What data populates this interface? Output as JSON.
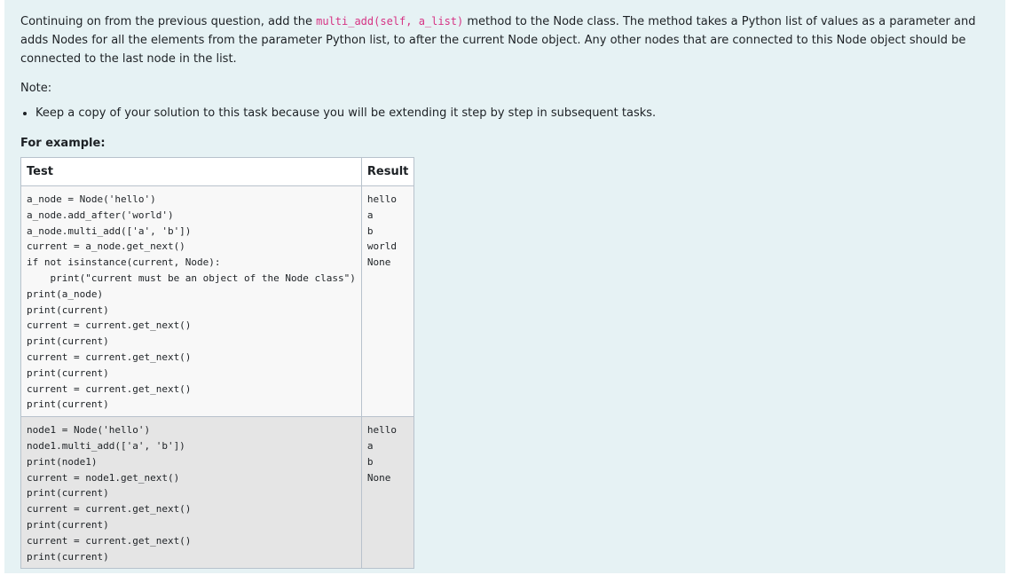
{
  "question": {
    "text_before": "Continuing on from the previous question, add the ",
    "method_signature": "multi_add(self, a_list)",
    "text_after": " method to the Node class. The method takes a Python list of values as a parameter and adds Nodes for all the elements from the parameter Python list, to after the current Node object. Any other nodes that are connected to this Node object should be connected to the last node in the list.",
    "note_label": "Note:",
    "bullets": [
      "Keep a copy of your solution to this task because you will be extending it step by step in subsequent tasks."
    ],
    "example_heading": "For example:"
  },
  "examples_table": {
    "headers": {
      "test": "Test",
      "result": "Result"
    },
    "rows": [
      {
        "test": "a_node = Node('hello')\na_node.add_after('world')\na_node.multi_add(['a', 'b'])\ncurrent = a_node.get_next()\nif not isinstance(current, Node):\n    print(\"current must be an object of the Node class\")\nprint(a_node)\nprint(current)\ncurrent = current.get_next()\nprint(current)\ncurrent = current.get_next()\nprint(current)\ncurrent = current.get_next()\nprint(current)",
        "result": "hello\na\nb\nworld\nNone"
      },
      {
        "test": "node1 = Node('hello')\nnode1.multi_add(['a', 'b'])\nprint(node1)\ncurrent = node1.get_next()\nprint(current)\ncurrent = current.get_next()\nprint(current)\ncurrent = current.get_next()\nprint(current)",
        "result": "hello\na\nb\nNone"
      }
    ]
  }
}
